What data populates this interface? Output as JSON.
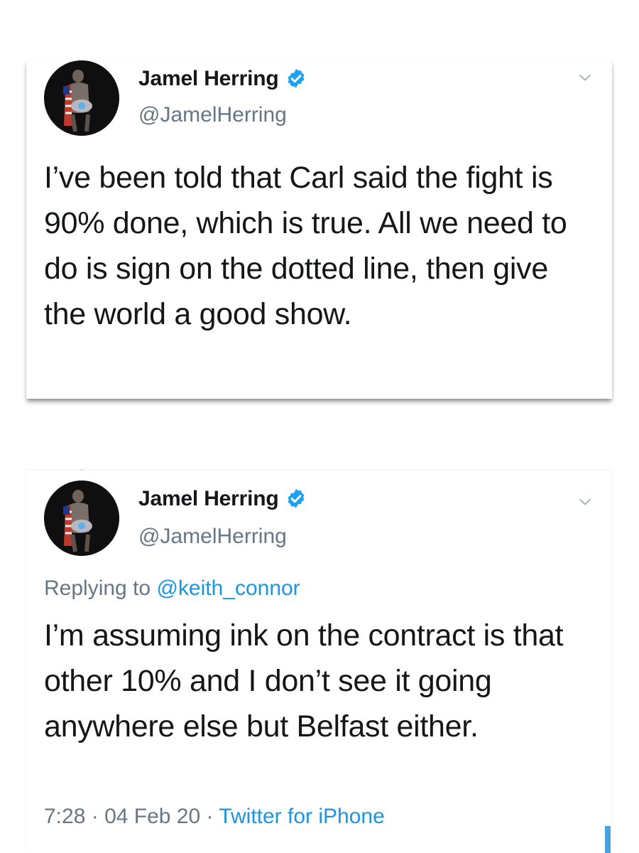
{
  "colors": {
    "text_primary": "#14171a",
    "text_secondary": "#657786",
    "link": "#1b95e0",
    "verified_badge": "#1da1f2"
  },
  "tweets": [
    {
      "author": {
        "display_name": "Jamel Herring",
        "handle": "@JamelHerring",
        "verified": true
      },
      "text": "I’ve been told that Carl said the fight is 90% done, which is true. All we need to do is sign on the dotted line, then give the world a good show."
    },
    {
      "author": {
        "display_name": "Jamel Herring",
        "handle": "@JamelHerring",
        "verified": true
      },
      "reply_prefix": "Replying to",
      "reply_to": "@keith_connor",
      "text": "I’m assuming ink on the contract is that other 10% and I don’t see it going anywhere else but Belfast either.",
      "time": "7:28",
      "separator": "·",
      "date": "04 Feb 20",
      "source": "Twitter for iPhone"
    }
  ]
}
